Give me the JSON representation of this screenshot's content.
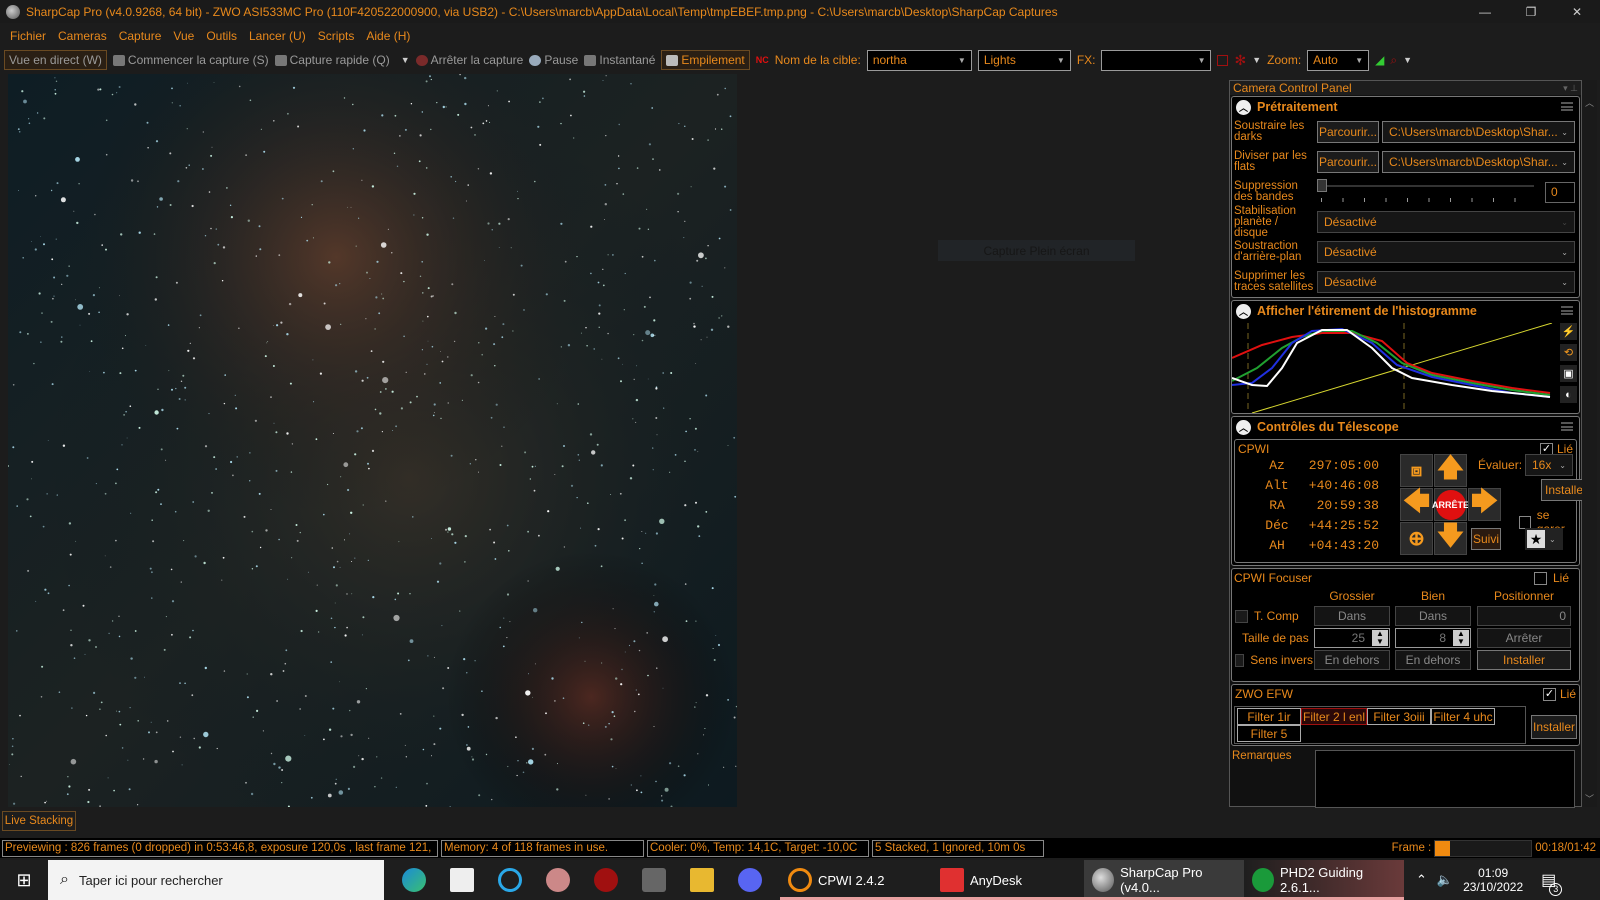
{
  "titlebar": {
    "title": "SharpCap Pro (v4.0.9268, 64 bit) - ZWO ASI533MC Pro (110F420522000900, via USB2) - C:\\Users\\marcb\\AppData\\Local\\Temp\\tmpEBEF.tmp.png - C:\\Users\\marcb\\Desktop\\SharpCap Captures",
    "minimize": "—",
    "maximize": "❐",
    "close": "✕"
  },
  "menu": [
    "Fichier",
    "Cameras",
    "Capture",
    "Vue",
    "Outils",
    "Lancer (U)",
    "Scripts",
    "Aide (H)"
  ],
  "toolbar": {
    "live_view": "Vue en direct (W)",
    "start_capture": "Commencer la capture (S)",
    "quick_capture": "Capture rapide (Q)",
    "stop_capture": "Arrêter la capture",
    "pause": "Pause",
    "snapshot": "Instantané",
    "stacking": "Empilement",
    "target_label": "Nom de la cible:",
    "target_value": "northa",
    "frame_type": "Lights",
    "fx_label": "FX:",
    "fx_value": "",
    "zoom_label": "Zoom:",
    "zoom_value": "Auto"
  },
  "viewer": {
    "overlay_button": "Capture Plein écran"
  },
  "panel": {
    "title": "Camera Control Panel",
    "preprocessing": {
      "title": "Prétraitement",
      "darks_label": "Soustraire les darks",
      "darks_browse": "Parcourir...",
      "darks_path": "C:\\Users\\marcb\\Desktop\\Shar...",
      "flats_label": "Diviser par les flats",
      "flats_browse": "Parcourir...",
      "flats_path": "C:\\Users\\marcb\\Desktop\\Shar...",
      "banding_label": "Suppression des bandes",
      "banding_value": "0",
      "stabilisation_label": "Stabilisation planète / disque",
      "stabilisation_value": "Désactivé",
      "background_label": "Soustraction d'arrière-plan",
      "background_value": "Désactivé",
      "satellite_label": "Supprimer les traces satellites",
      "satellite_value": "Désactivé"
    },
    "histogram": {
      "title": "Afficher l'étirement de l'histogramme"
    },
    "telescope": {
      "title": "Contrôles du Télescope",
      "mount": "CPWI",
      "linked_label": "Lié",
      "linked": true,
      "coords": [
        {
          "k": "Az",
          "v": "297:05:00"
        },
        {
          "k": "Alt",
          "v": "+40:46:08"
        },
        {
          "k": "RA",
          "v": "20:59:38"
        },
        {
          "k": "Déc",
          "v": "+44:25:52"
        },
        {
          "k": "AH",
          "v": "+04:43:20"
        }
      ],
      "stop": "ARRÊTE",
      "rate_label": "Évaluer:",
      "rate_value": "16x",
      "setup": "Installer",
      "park_label": "se garer",
      "tracking": "Suivi"
    },
    "focuser": {
      "title": "CPWI Focuser",
      "linked_label": "Lié",
      "coarse": "Grossier",
      "fine": "Bien",
      "position": "Positionner",
      "tcomp": "T. Comp",
      "in": "Dans",
      "position_value": "0",
      "step_label": "Taille de pas",
      "coarse_step": "25",
      "fine_step": "8",
      "stop": "Arrêter",
      "reverse": "Sens invers",
      "out": "En dehors",
      "setup": "Installer"
    },
    "efw": {
      "title": "ZWO EFW",
      "linked_label": "Lié",
      "filters": [
        "Filter 1ir",
        "Filter 2 l enl",
        "Filter 3oiii",
        "Filter 4 uhc",
        "Filter 5"
      ],
      "active_filter": 1,
      "setup": "Installer"
    },
    "notes": {
      "label": "Remarques",
      "value": ""
    }
  },
  "live_stacking": "Live Stacking",
  "status": {
    "preview": "Previewing : 826 frames (0 dropped) in 0:53:46,8, exposure 120,0s , last frame 121,",
    "memory": "Memory: 4 of 118 frames in use.",
    "cooler": "Cooler: 0%, Temp: 14,1C, Target: -10,0C",
    "stack": "5 Stacked, 1 Ignored, 10m 0s",
    "frame_label": "Frame :",
    "frame_progress": 0.15,
    "frame_time": "00:18/01:42"
  },
  "taskbar": {
    "search_placeholder": "Taper ici pour rechercher",
    "apps": [
      "CPWI 2.4.2",
      "AnyDesk",
      "SharpCap Pro (v4.0...",
      "PHD2 Guiding 2.6.1..."
    ],
    "time": "01:09",
    "date": "23/10/2022",
    "notifications": "3"
  },
  "colors": {
    "accent": "#e8891c",
    "stop": "#e01010",
    "arrow": "#f59a1e"
  }
}
